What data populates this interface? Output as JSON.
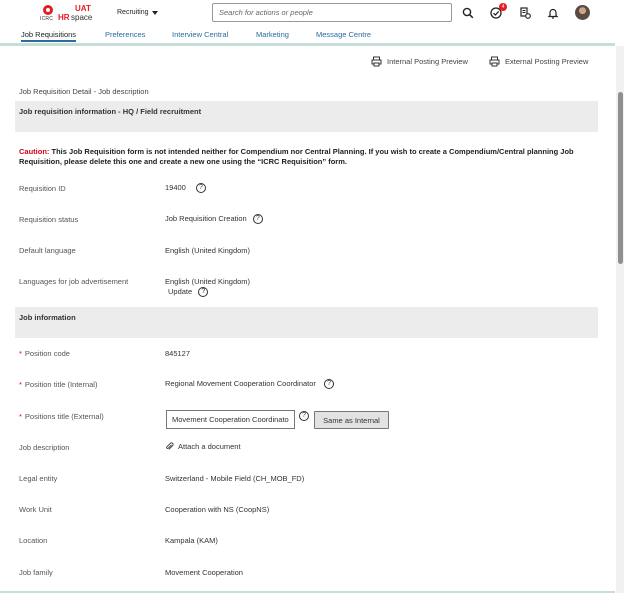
{
  "header": {
    "logo": {
      "org": "ICRC",
      "brand_hr": "HR",
      "brand_space": "space",
      "env": "UAT"
    },
    "module_label": "Recruiting",
    "search_placeholder": "Search for actions or people",
    "notification_count": "4"
  },
  "tabs": [
    {
      "label": "Job Requisitions",
      "active": true
    },
    {
      "label": "Preferences"
    },
    {
      "label": "Interview Central"
    },
    {
      "label": "Marketing"
    },
    {
      "label": "Message Centre"
    }
  ],
  "preview": {
    "internal_label": "Internal Posting Preview",
    "external_label": "External Posting Preview"
  },
  "breadcrumb": "Job Requisition Detail - Job description",
  "sections": {
    "requisition_info": "Job requisition information - HQ / Field recruitment",
    "job_info": "Job information"
  },
  "caution": {
    "word": "Caution:",
    "text": "This Job Requisition form is not intended neither for Compendium nor Central Planning. If you wish to create a Compendium/Central planning Job Requisition, please delete this one and create a new one using the “ICRC Requisition” form."
  },
  "fields": {
    "requisition_id": {
      "label": "Requisition ID",
      "value": "19400"
    },
    "requisition_status": {
      "label": "Requisition status",
      "value": "Job Requisition Creation"
    },
    "default_language": {
      "label": "Default language",
      "value": "English (United Kingdom)"
    },
    "languages_ad": {
      "label": "Languages for job advertisement",
      "value": "English (United Kingdom)",
      "update_label": "Update"
    },
    "position_code": {
      "label": "Position code",
      "value": "845127",
      "required_mark": "*"
    },
    "position_title_internal": {
      "label": "Position title (Internal)",
      "value": "Regional Movement Cooperation Coordinator",
      "required_mark": "*"
    },
    "position_title_external": {
      "label": "Positions title (External)",
      "value": "Movement Cooperation Coordinator",
      "required_mark": "*",
      "button_label": "Same as Internal"
    },
    "job_description": {
      "label": "Job description",
      "attach_label": "Attach a document"
    },
    "legal_entity": {
      "label": "Legal entity",
      "value": "Switzerland - Mobile Field (CH_MOB_FD)"
    },
    "work_unit": {
      "label": "Work Unit",
      "value": "Cooperation with NS (CoopNS)"
    },
    "location": {
      "label": "Location",
      "value": "Kampala (KAM)"
    },
    "job_family": {
      "label": "Job family",
      "value": "Movement Cooperation"
    }
  },
  "colors": {
    "link": "#2a6c9e",
    "caution_red": "#d0021b",
    "section_bg": "#ececec",
    "tab_underline": "#c7ddd9"
  },
  "icons": {
    "search": "search-icon",
    "todo": "checkmark-circle-icon",
    "approvals": "approvals-icon",
    "notifications": "bell-icon",
    "help": "question-circle-icon",
    "preview": "printer-preview-icon",
    "attach": "paperclip-icon"
  }
}
